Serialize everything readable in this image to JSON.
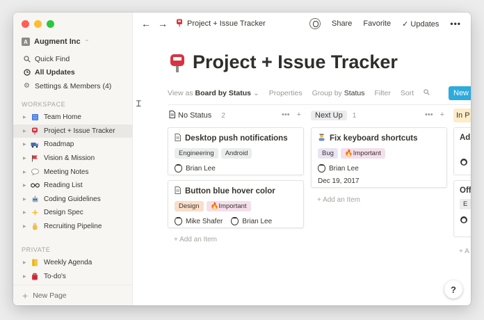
{
  "sidebar": {
    "workspace_name": "Augment Inc",
    "workspace_logo": "A",
    "nav": [
      {
        "icon": "search-icon",
        "label": "Quick Find"
      },
      {
        "icon": "clock-icon",
        "label": "All Updates"
      },
      {
        "icon": "gear-icon",
        "label": "Settings & Members (4)"
      }
    ],
    "workspace_label": "WORKSPACE",
    "workspace_pages": [
      {
        "icon": "map-book-icon",
        "label": "Team Home"
      },
      {
        "icon": "postbox-icon",
        "label": "Project + Issue Tracker"
      },
      {
        "icon": "truck-icon",
        "label": "Roadmap"
      },
      {
        "icon": "flag-icon",
        "label": "Vision & Mission"
      },
      {
        "icon": "speech-bubble-icon",
        "label": "Meeting Notes"
      },
      {
        "icon": "glasses-icon",
        "label": "Reading List"
      },
      {
        "icon": "robot-icon",
        "label": "Coding Guidelines"
      },
      {
        "icon": "sparkles-icon",
        "label": "Design Spec"
      },
      {
        "icon": "hand-icon",
        "label": "Recruiting Pipeline"
      }
    ],
    "private_label": "PRIVATE",
    "private_pages": [
      {
        "icon": "notebook-icon",
        "label": "Weekly Agenda"
      },
      {
        "icon": "backpack-icon",
        "label": "To-do's"
      }
    ],
    "new_page": "New Page"
  },
  "topbar": {
    "breadcrumb": "Project + Issue Tracker",
    "share": "Share",
    "favorite": "Favorite",
    "updates": "Updates",
    "more": "•••"
  },
  "page": {
    "title": "Project + Issue Tracker"
  },
  "viewbar": {
    "view_as": "View as",
    "view_value": "Board by Status",
    "properties": "Properties",
    "group_by": "Group by",
    "group_value": "Status",
    "filter": "Filter",
    "sort": "Sort",
    "new_button": "New It"
  },
  "board": {
    "columns": [
      {
        "name": "No Status",
        "count": "2",
        "cards": [
          {
            "title": "Desktop push notifications",
            "tags": [
              {
                "label": "Engineering",
                "bg": "#ebeced"
              },
              {
                "label": "Android",
                "bg": "#ebeced"
              }
            ],
            "people": [
              "Brian Lee"
            ]
          },
          {
            "title": "Button blue hover color",
            "tags": [
              {
                "label": "Design",
                "bg": "#fadec9"
              },
              {
                "label": "🔥Important",
                "bg": "#f4dfeb"
              }
            ],
            "people": [
              "Mike Shafer",
              "Brian Lee"
            ]
          }
        ],
        "add": "+ Add an Item"
      },
      {
        "name": "Next Up",
        "count": "1",
        "cards": [
          {
            "title": "Fix keyboard shortcuts",
            "tags": [
              {
                "label": "Bug",
                "bg": "#eae4f2"
              },
              {
                "label": "🔥Important",
                "bg": "#f4dfeb"
              }
            ],
            "people": [
              "Brian Lee"
            ],
            "date": "Dec 19, 2017"
          }
        ],
        "add": "+ Add an Item"
      }
    ],
    "clipped_column": {
      "name": "In P",
      "card1_text": "Ad",
      "card2_text": "Off",
      "tag_initial": "E",
      "add": "+ A"
    }
  },
  "help": "?",
  "colors": {
    "accent": "#2eaadc",
    "next_up_pill": "#ebeced",
    "sidebar_bg": "#f7f6f3"
  }
}
